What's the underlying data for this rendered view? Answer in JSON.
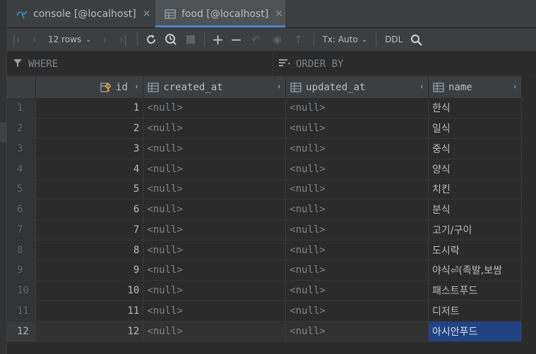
{
  "tabs": [
    {
      "label": "console [@localhost]",
      "icon": "sql-console-icon",
      "active": false
    },
    {
      "label": "food [@localhost]",
      "icon": "table-icon",
      "active": true
    }
  ],
  "toolbar": {
    "rows_label": "12 rows",
    "tx_label": "Tx: Auto",
    "ddl_label": "DDL"
  },
  "filters": {
    "where_label": "WHERE",
    "order_label": "ORDER BY"
  },
  "columns": [
    {
      "label": "id",
      "icon": "primary-key-icon"
    },
    {
      "label": "created_at",
      "icon": "column-icon"
    },
    {
      "label": "updated_at",
      "icon": "column-icon"
    },
    {
      "label": "name",
      "icon": "column-icon"
    }
  ],
  "rows": [
    {
      "rn": "1",
      "id": "1",
      "created_at": "<null>",
      "updated_at": "<null>",
      "name": "한식"
    },
    {
      "rn": "2",
      "id": "2",
      "created_at": "<null>",
      "updated_at": "<null>",
      "name": "일식"
    },
    {
      "rn": "3",
      "id": "3",
      "created_at": "<null>",
      "updated_at": "<null>",
      "name": "중식"
    },
    {
      "rn": "4",
      "id": "4",
      "created_at": "<null>",
      "updated_at": "<null>",
      "name": "양식"
    },
    {
      "rn": "5",
      "id": "5",
      "created_at": "<null>",
      "updated_at": "<null>",
      "name": "치킨"
    },
    {
      "rn": "6",
      "id": "6",
      "created_at": "<null>",
      "updated_at": "<null>",
      "name": "분식"
    },
    {
      "rn": "7",
      "id": "7",
      "created_at": "<null>",
      "updated_at": "<null>",
      "name": "고기/구이"
    },
    {
      "rn": "8",
      "id": "8",
      "created_at": "<null>",
      "updated_at": "<null>",
      "name": "도시락"
    },
    {
      "rn": "9",
      "id": "9",
      "created_at": "<null>",
      "updated_at": "<null>",
      "name": "야식⏎(족발,보쌈"
    },
    {
      "rn": "10",
      "id": "10",
      "created_at": "<null>",
      "updated_at": "<null>",
      "name": "패스트푸드"
    },
    {
      "rn": "11",
      "id": "11",
      "created_at": "<null>",
      "updated_at": "<null>",
      "name": "디저트"
    },
    {
      "rn": "12",
      "id": "12",
      "created_at": "<null>",
      "updated_at": "<null>",
      "name": "아시안푸드"
    }
  ],
  "selected_row": 12,
  "colors": {
    "accent": "#4a88c7",
    "selection": "#214283",
    "background": "#2b2b2b"
  }
}
